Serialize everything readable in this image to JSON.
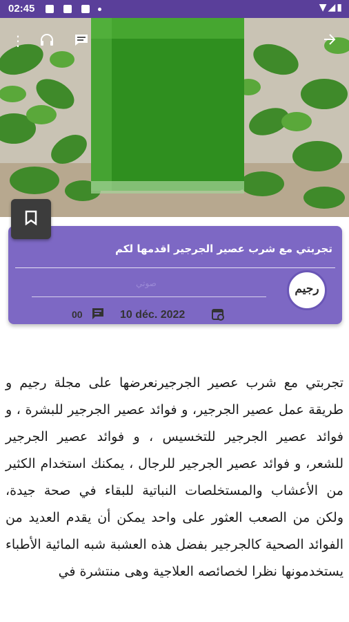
{
  "status_bar": {
    "time": "02:45"
  },
  "toolbar": {
    "icons": [
      "overflow-menu-icon",
      "headphones-icon",
      "comments-icon",
      "forward-arrow-icon"
    ]
  },
  "bookmark": {
    "icon": "bookmark-icon"
  },
  "article": {
    "title": "تجربتي مع شرب عصير الجرجير اقدمها لكم",
    "author": "صوتي",
    "date": "10 déc. 2022",
    "comment_count": "00",
    "logo_text": "رجيم",
    "body": "تجربتي مع شرب عصير الجرجيرنعرضها على مجلة رجيم و طريقة عمل عصير الجرجير، و فوائد عصير الجرجير للبشرة ، و فوائد عصير الجرجير للتخسيس ، و فوائد عصير الجرجير للشعر، و فوائد عصير الجرجير للرجال ، يمكنك استخدام الكثير من الأعشاب والمستخلصات النباتية للبقاء في صحة جيدة، ولكن من الصعب العثور على واحد يمكن أن يقدم العديد من الفوائد الصحية كالجرجير بفضل هذه العشبة شبه المائية الأطباء يستخدمونها نظرا لخصائصه العلاجية وهى منتشرة في"
  },
  "colors": {
    "status_bar": "#5a3f9a",
    "card": "#7d68c4",
    "bookmark_button": "#3c3c3c"
  }
}
